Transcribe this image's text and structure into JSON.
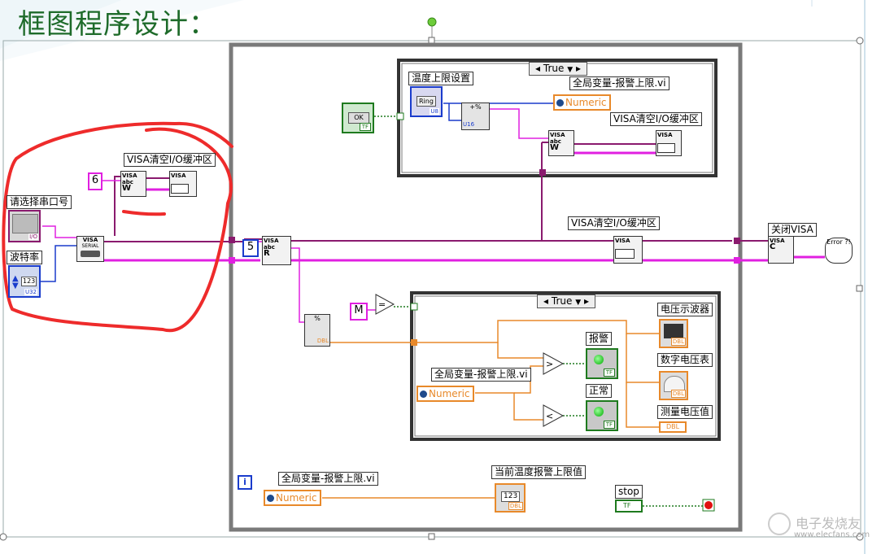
{
  "heading": "框图程序设计：",
  "labels": {
    "serial_port": "请选择串口号",
    "baud_rate": "波特率",
    "visa_flush_left": "VISA清空I/O缓冲区",
    "visa_flush_mid": "VISA清空I/O缓冲区",
    "visa_flush_top": "VISA清空I/O缓冲区",
    "temp_limit_set": "温度上限设置",
    "global_alarm_top": "全局变量-报警上限.vi",
    "global_alarm_mid": "全局变量-报警上限.vi",
    "global_alarm_bottom": "全局变量-报警上限.vi",
    "close_visa": "关闭VISA",
    "voltage_scope": "电压示波器",
    "digital_voltmeter": "数字电压表",
    "measured_voltage": "测量电压值",
    "alarm": "报警",
    "normal": "正常",
    "current_temp_limit": "当前温度报警上限值",
    "stop": "stop"
  },
  "constants": {
    "six": "6",
    "five": "5",
    "m": "M",
    "ok": "OK",
    "iter": "i"
  },
  "case_selectors": {
    "top": "True",
    "bottom": "True"
  },
  "globals": {
    "top": "Numeric",
    "mid": "Numeric",
    "bottom": "Numeric"
  },
  "node_text": {
    "ring": "Ring",
    "u8": "U8",
    "u16": "U16",
    "dbl": "DBL",
    "tf": "TF",
    "i_o": "I/O",
    "i23": "123",
    "error": "Error ?!",
    "visa": "VISA",
    "serial": "SERIAL",
    "abc": "abc",
    "w": "W",
    "r": "R",
    "c": "C"
  },
  "watermark": {
    "brand": "电子发烧友",
    "url": "www.elecfans.com"
  },
  "colors": {
    "heading": "#1e6b2a",
    "loop_border": "#7a7a7a",
    "string_wire": "#e020e0",
    "visa_wire": "#8a1a6e",
    "numeric_wire": "#e8892a",
    "int_wire": "#1a3ccc",
    "bool_wire": "#1e7a1e",
    "annotation": "#ee2b2b"
  }
}
